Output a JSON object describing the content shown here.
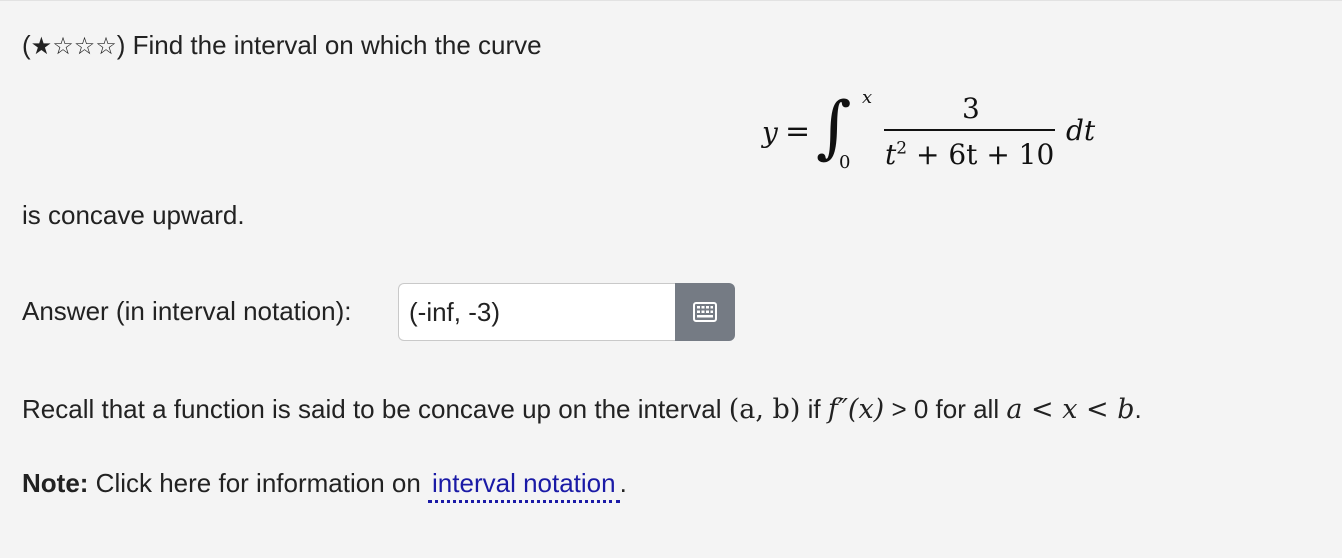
{
  "question": {
    "stars_filled": "★",
    "stars_empty": "☆☆☆",
    "prompt": "Find the interval on which the curve",
    "suffix": "is concave upward."
  },
  "formula": {
    "lhs": "y",
    "equals": "=",
    "integral_sign": "∫",
    "upper_limit": "x",
    "lower_limit": "0",
    "numerator": "3",
    "denominator_base": "t",
    "denominator_exponent": "2",
    "denominator_rest": " + 6t + 10",
    "differential": "dt"
  },
  "answer": {
    "label": "Answer (in interval notation):",
    "value": "(-inf, -3)",
    "keyboard_icon": "keyboard-icon"
  },
  "recall": {
    "text_1": "Recall that a function is said to be concave up on the interval ",
    "interval": "(a, b)",
    "text_2": " if ",
    "condition_fn": "f″(x)",
    "text_3": " > 0 for all ",
    "range": "a < x < b",
    "text_4": "."
  },
  "note": {
    "bold": "Note:",
    "text": " Click here for information on ",
    "link": "interval notation",
    "end": "."
  },
  "colors": {
    "background": "#f4f4f4",
    "link": "#1a1aa6",
    "button": "#757b84"
  }
}
